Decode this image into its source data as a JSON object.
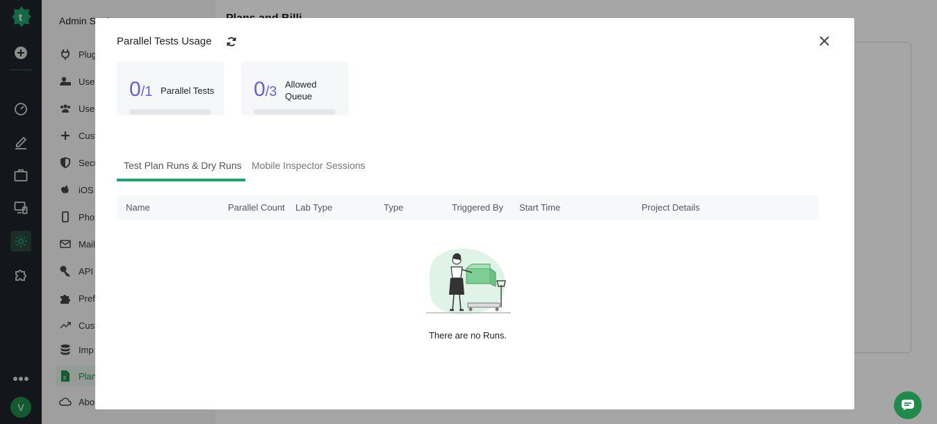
{
  "sidebar": {
    "title": "Admin Setti",
    "items": [
      {
        "label": "Plug",
        "icon": "plug-icon"
      },
      {
        "label": "User",
        "icon": "user-lock-icon"
      },
      {
        "label": "User",
        "icon": "users-icon"
      },
      {
        "label": "Cust",
        "icon": "plus-icon"
      },
      {
        "label": "Secu",
        "icon": "shield-icon"
      },
      {
        "label": "iOS",
        "icon": "apple-icon"
      },
      {
        "label": "Phon",
        "icon": "phone-icon"
      },
      {
        "label": "Mail",
        "icon": "mail-icon"
      },
      {
        "label": "API",
        "icon": "key-icon"
      },
      {
        "label": "Pref",
        "icon": "puzzle-icon"
      },
      {
        "label": "Cust",
        "icon": "trend-icon"
      },
      {
        "label": "Imp",
        "icon": "database-icon"
      },
      {
        "label": "Plan",
        "icon": "invoice-icon"
      },
      {
        "label": "Abo",
        "icon": "cloud-icon"
      }
    ]
  },
  "main": {
    "title": "Plans and Billi"
  },
  "rail": {
    "avatar_letter": "V"
  },
  "modal": {
    "title": "Parallel Tests Usage",
    "stats": [
      {
        "used": "0",
        "total": "/1",
        "label": "Parallel Tests",
        "progress": 0
      },
      {
        "used": "0",
        "total": "/3",
        "label": "Allowed Queue",
        "progress": 0
      }
    ],
    "tabs": [
      "Test Plan Runs & Dry Runs",
      "Mobile Inspector Sessions"
    ],
    "active_tab": 0,
    "columns": [
      "Name",
      "Parallel Count",
      "Lab Type",
      "Type",
      "Triggered By",
      "Start Time",
      "Project Details"
    ],
    "empty_text": "There are no Runs."
  },
  "colors": {
    "brand": "#1f8a4c",
    "accent": "#6a5fd6",
    "tab_underline": "#1f9e6e"
  }
}
